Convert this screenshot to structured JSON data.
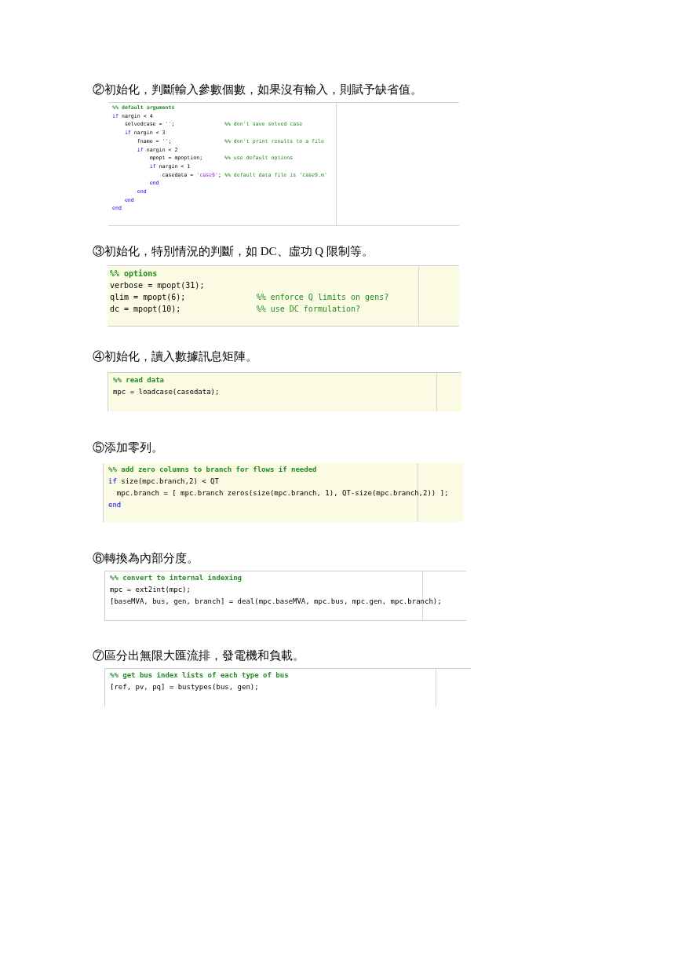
{
  "sections": [
    {
      "heading": "②初始化，判斷輸入參數個數，如果沒有輸入，則賦予缺省值。",
      "code": {
        "kind": "plain",
        "lines": [
          {
            "segments": [
              {
                "kind": "cell_title",
                "text": "%% default arguments"
              }
            ]
          },
          {
            "segments": [
              {
                "kind": "keyword",
                "text": "if"
              },
              {
                "kind": "code",
                "text": " nargin < 4"
              }
            ]
          },
          {
            "segments": [
              {
                "kind": "code",
                "text": "    solvedcase = "
              },
              {
                "kind": "string",
                "text": "''"
              },
              {
                "kind": "code",
                "text": ";"
              },
              {
                "kind": "comment",
                "text": "%% don't save solved case"
              }
            ]
          },
          {
            "segments": [
              {
                "kind": "keyword",
                "text": "    if"
              },
              {
                "kind": "code",
                "text": " nargin < 3"
              }
            ]
          },
          {
            "segments": [
              {
                "kind": "code",
                "text": "        fname = "
              },
              {
                "kind": "string",
                "text": "''"
              },
              {
                "kind": "code",
                "text": ";"
              },
              {
                "kind": "comment",
                "text": "%% don't print results to a file"
              }
            ]
          },
          {
            "segments": [
              {
                "kind": "keyword",
                "text": "        if"
              },
              {
                "kind": "code",
                "text": " nargin < 2"
              }
            ]
          },
          {
            "segments": [
              {
                "kind": "code",
                "text": "            mpopt = mpoption;"
              },
              {
                "kind": "comment",
                "text": "%% use default options"
              }
            ]
          },
          {
            "segments": [
              {
                "kind": "keyword",
                "text": "            if"
              },
              {
                "kind": "code",
                "text": " nargin < 1"
              }
            ]
          },
          {
            "segments": [
              {
                "kind": "code",
                "text": "                casedata = "
              },
              {
                "kind": "string",
                "text": "'case9'"
              },
              {
                "kind": "code",
                "text": ";"
              },
              {
                "kind": "comment",
                "text": "%% default data file is 'case9.m'"
              }
            ]
          },
          {
            "segments": [
              {
                "kind": "keyword",
                "text": "            end"
              }
            ]
          },
          {
            "segments": [
              {
                "kind": "keyword",
                "text": "        end"
              }
            ]
          },
          {
            "segments": [
              {
                "kind": "keyword",
                "text": "    end"
              }
            ]
          },
          {
            "segments": [
              {
                "kind": "keyword",
                "text": "end"
              }
            ]
          }
        ]
      }
    },
    {
      "heading": "③初始化，特別情況的判斷，如 DC、虛功 Q 限制等。",
      "code": {
        "kind": "highlighted",
        "lines": [
          {
            "segments": [
              {
                "kind": "cell_title",
                "text": "%% options"
              }
            ]
          },
          {
            "segments": [
              {
                "kind": "code",
                "text": "verbose = mpopt(31);"
              }
            ]
          },
          {
            "segments": [
              {
                "kind": "code",
                "text": "qlim = mpopt(6);"
              },
              {
                "kind": "comment",
                "text": "%% enforce Q limits on gens?"
              }
            ]
          },
          {
            "segments": [
              {
                "kind": "code",
                "text": "dc = mpopt(10);"
              },
              {
                "kind": "comment",
                "text": "%% use DC formulation?"
              }
            ]
          }
        ]
      }
    },
    {
      "heading": "④初始化，讀入數據訊息矩陣。",
      "code": {
        "kind": "highlighted",
        "lines": [
          {
            "segments": [
              {
                "kind": "cell_title",
                "text": "%% read data"
              }
            ]
          },
          {
            "segments": [
              {
                "kind": "code",
                "text": "mpc = loadcase(casedata);"
              }
            ]
          }
        ]
      }
    },
    {
      "heading": "⑤添加零列。",
      "code": {
        "kind": "highlighted",
        "lines": [
          {
            "segments": [
              {
                "kind": "cell_title",
                "text": "%% add zero columns to branch for flows if needed"
              }
            ]
          },
          {
            "segments": [
              {
                "kind": "keyword",
                "text": "if"
              },
              {
                "kind": "code",
                "text": " size(mpc.branch,2) < QT"
              }
            ]
          },
          {
            "segments": [
              {
                "kind": "code",
                "text": "  mpc.branch = [ mpc.branch zeros(size(mpc.branch, 1), QT-size(mpc.branch,2)) ];"
              }
            ]
          },
          {
            "segments": [
              {
                "kind": "keyword",
                "text": "end"
              }
            ]
          }
        ]
      }
    },
    {
      "heading": "⑥轉換為內部分度。",
      "code": {
        "kind": "plain",
        "lines": [
          {
            "segments": [
              {
                "kind": "cell_title",
                "text": "%% convert to internal indexing"
              }
            ]
          },
          {
            "segments": [
              {
                "kind": "code",
                "text": "mpc = ext2int(mpc);"
              }
            ]
          },
          {
            "segments": [
              {
                "kind": "code",
                "text": "[baseMVA, bus, gen, branch] = deal(mpc.baseMVA, mpc.bus, mpc.gen, mpc.branch);"
              }
            ]
          }
        ]
      }
    },
    {
      "heading": "⑦區分出無限大匯流排，發電機和負載。",
      "code": {
        "kind": "plain",
        "lines": [
          {
            "segments": [
              {
                "kind": "cell_title",
                "text": "%% get bus index lists of each type of bus"
              }
            ]
          },
          {
            "segments": [
              {
                "kind": "code",
                "text": "[ref, pv, pq] = bustypes(bus, gen);"
              }
            ]
          }
        ]
      }
    }
  ]
}
